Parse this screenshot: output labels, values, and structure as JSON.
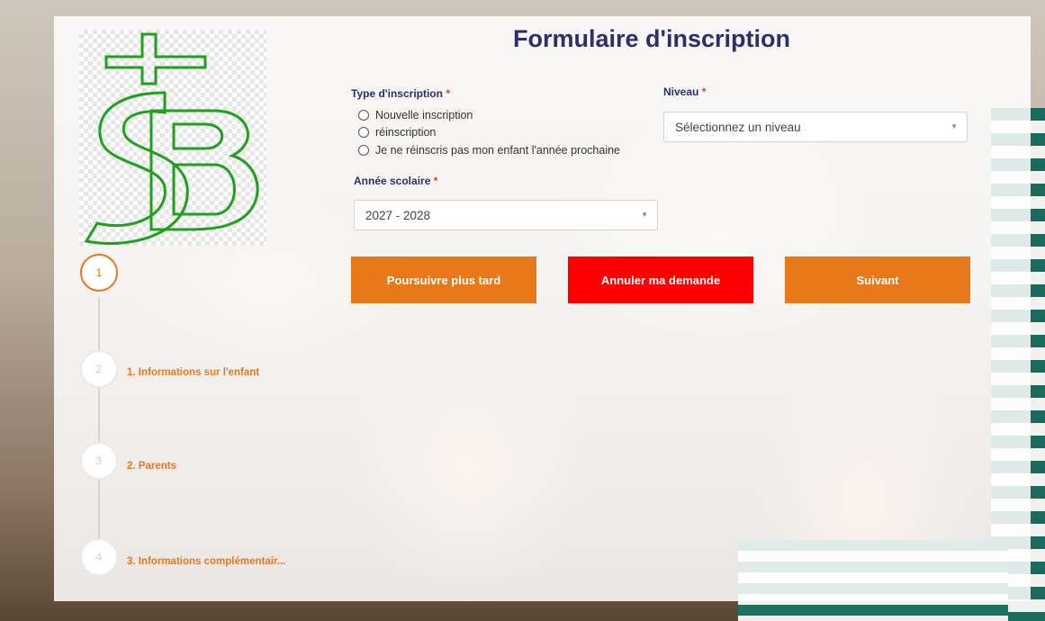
{
  "title": "Formulaire d'inscription",
  "type_inscription": {
    "label": "Type d'inscription",
    "required_mark": "*",
    "options": [
      "Nouvelle inscription",
      "réinscription",
      "Je ne réinscris pas mon enfant l'année prochaine"
    ]
  },
  "niveau": {
    "label": "Niveau",
    "required_mark": "*",
    "selected": "Sélectionnez un niveau"
  },
  "annee_scolaire": {
    "label": "Année scolaire",
    "required_mark": "*",
    "selected": "2027 - 2028"
  },
  "buttons": {
    "later": "Poursuivre plus tard",
    "cancel": "Annuler ma demande",
    "next": "Suivant"
  },
  "steps": [
    {
      "number": "1",
      "label": ""
    },
    {
      "number": "2",
      "label": "1. Informations sur l'enfant"
    },
    {
      "number": "3",
      "label": "2. Parents"
    },
    {
      "number": "4",
      "label": "3. Informations complémentair..."
    }
  ],
  "colors": {
    "primary": "#e8781a",
    "danger": "#ff0000",
    "title": "#2b2f6b",
    "logo_green": "#1fa01f"
  },
  "icons": {
    "caret": "caret-down-icon"
  }
}
